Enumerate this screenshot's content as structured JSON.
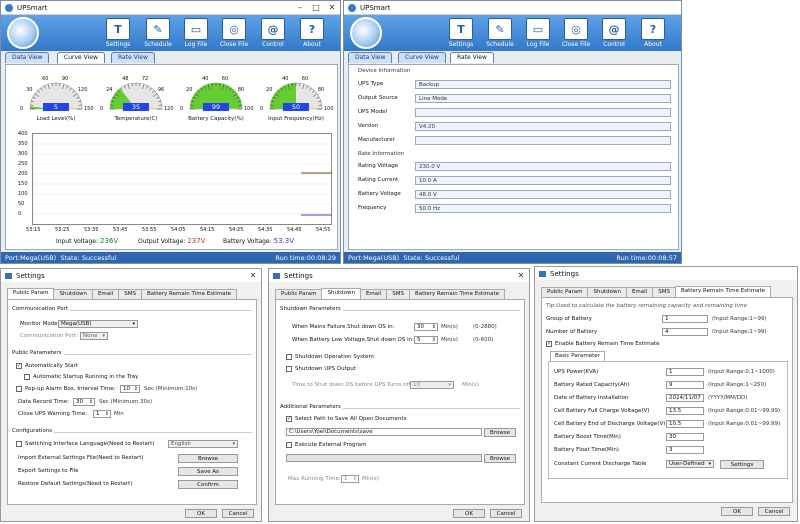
{
  "app_title": "UPSmart",
  "toolbar": [
    "Settings",
    "Schedule",
    "Log File",
    "Close File",
    "Control",
    "About"
  ],
  "view_tabs": [
    "Data View",
    "Curve View",
    "Rate View"
  ],
  "gauges": [
    {
      "label": "Load Level(%)",
      "value": "5",
      "ticks": [
        "0",
        "30",
        "60",
        "90",
        "120",
        "150"
      ],
      "level": 0.03
    },
    {
      "label": "Temperature(C)",
      "value": "35",
      "ticks": [
        "0",
        "24",
        "48",
        "72",
        "96",
        "120"
      ],
      "level": 0.29
    },
    {
      "label": "Battery Capacity(%)",
      "value": "99",
      "ticks": [
        "0",
        "20",
        "40",
        "60",
        "80",
        "100"
      ],
      "level": 0.99
    },
    {
      "label": "Input Frequency(Hz)",
      "value": "50",
      "ticks": [
        "0",
        "20",
        "40",
        "60",
        "80",
        "100"
      ],
      "level": 0.5
    }
  ],
  "curve_y_ticks": [
    "400",
    "350",
    "300",
    "250",
    "200",
    "150",
    "100",
    "50",
    "0"
  ],
  "curve_x_ticks": [
    "53:15",
    "53:25",
    "53:35",
    "53:45",
    "53:55",
    "54:05",
    "54:15",
    "54:25",
    "54:35",
    "54:45",
    "54:55"
  ],
  "readouts": {
    "input_label": "Input Voltage:",
    "input_value": "236V",
    "output_label": "Output Voltage:",
    "output_value": "237V",
    "battery_label": "Battery Voltage:",
    "battery_value": "53.3V"
  },
  "status1": {
    "port": "Port:Mega(USB)",
    "state": "State: Successful",
    "runtime": "Run time:00:08:29"
  },
  "status2": {
    "port": "Port:Mega(USB)",
    "state": "State: Successful",
    "runtime": "Run time:00:08:57"
  },
  "rate_view": {
    "device_info": "Device Information",
    "device_fields": [
      {
        "label": "UPS Type",
        "value": "Backup"
      },
      {
        "label": "Output Source",
        "value": "Line Mode"
      },
      {
        "label": "UPS Model",
        "value": ""
      },
      {
        "label": "Version",
        "value": "V4.20"
      },
      {
        "label": "Manufacturer",
        "value": ""
      }
    ],
    "rate_info": "Rate Information",
    "rate_fields": [
      {
        "label": "Rating Voltage",
        "value": "230.0 V"
      },
      {
        "label": "Rating Current",
        "value": "10.0 A"
      },
      {
        "label": "Battery Voltage",
        "value": "48.0 V"
      },
      {
        "label": "Frequency",
        "value": "50.0 Hz"
      }
    ]
  },
  "settings": {
    "title": "Settings",
    "tabs": [
      "Public Param",
      "Shutdown",
      "Email",
      "SMS",
      "Battery Remain Time Estimate"
    ],
    "ok": "OK",
    "cancel": "Cancel",
    "public": {
      "comm_port": "Communication Port",
      "monitor_mode_label": "Monitor Mode:",
      "monitor_mode": "Mega(USB)",
      "comm_port_label": "Communication Port:",
      "comm_port_value": "None",
      "public_params": "Public Parameters",
      "auto_start": "Automatically Start",
      "auto_tray": "Automatic Startup Running in the Tray",
      "popup_label": "Pop-up Alarm Box, Interval Time:",
      "popup_value": "10",
      "popup_unit": "Sec  (Minimum:10s)",
      "record_label": "Data Record Time:",
      "record_value": "30",
      "record_unit": "Sec  (Minimum:30s)",
      "close_label": "Close UPS Warning Time:",
      "close_value": "1",
      "close_unit": "Min",
      "configurations": "Configurations",
      "switch_lang": "Switching Interface Language(Need to Restart)",
      "lang_value": "English",
      "import_label": "Import External Settings File(Need to Restart)",
      "import_btn": "Browse",
      "export_label": "Export Settings to File",
      "export_btn": "Save As",
      "restore_label": "Restore Default Settings(Need to Restart)",
      "restore_btn": "Confirm"
    },
    "shutdown": {
      "params": "Shutdown Parameters",
      "mains_label": "When Mains Failure,Shut down OS in:",
      "mains_value": "30",
      "mains_unit": "Min(s)",
      "mains_range": "(0-2880)",
      "battlow_label": "When Battery Low Voltage,Shut down OS in:",
      "battlow_value": "5",
      "battlow_unit": "Min(s)",
      "battlow_range": "(0-600)",
      "shutdown_os": "Shutdown Operation System",
      "shutdown_ups": "Shutdown UPS Output",
      "time_label": "Time to Shut down OS before UPS Turns off:",
      "time_value": "10",
      "time_unit": "Min(s)",
      "additional": "Additional Parameters",
      "save_path": "Select Path to Save All Open Documents",
      "path_value": "C:\\Users\\Yoel\\Documents\\save",
      "browse": "Browse",
      "exec_prog": "Execute External Program",
      "browse2": "Browse",
      "max_label": "Max Running Time:",
      "max_value": "1",
      "max_unit": "Min(s)"
    },
    "battery": {
      "tip": "Tip:Used to calculate the battery remaining capacity and remaining time",
      "group_label": "Group of Battery",
      "group_value": "1",
      "group_range": "(Input Range:1~99)",
      "num_label": "Number of Battery",
      "num_value": "4",
      "num_range": "(Input Range:1~99)",
      "enable": "Enable Battery Remain Time Estimate",
      "basic_tab": "Basic Parameter",
      "rows": [
        {
          "label": "UPS Power(KVA)",
          "value": "1",
          "hint": "(Input Range:0.1~1000)"
        },
        {
          "label": "Battery Rated Capacity(Ah)",
          "value": "9",
          "hint": "(Input Range:1~250)"
        },
        {
          "label": "Date of Battery Installation",
          "value": "2024/11/07",
          "hint": "(YYYY/MM/DD)"
        },
        {
          "label": "Cell Battery Full Charge Voltage(V)",
          "value": "13.5",
          "hint": "(Input Range:0.01~99.99)"
        },
        {
          "label": "Cell Battery End of Discharge Voltage(V)",
          "value": "10.5",
          "hint": "(Input Range:0.01~99.99)"
        },
        {
          "label": "Battery Boost Time(Min)",
          "value": "30",
          "hint": ""
        },
        {
          "label": "Battery Float Time(Min)",
          "value": "3",
          "hint": ""
        }
      ],
      "curve_label": "Constant Current Discharge Table",
      "curve_value": "User-Defined",
      "settings_btn": "Settings"
    }
  }
}
